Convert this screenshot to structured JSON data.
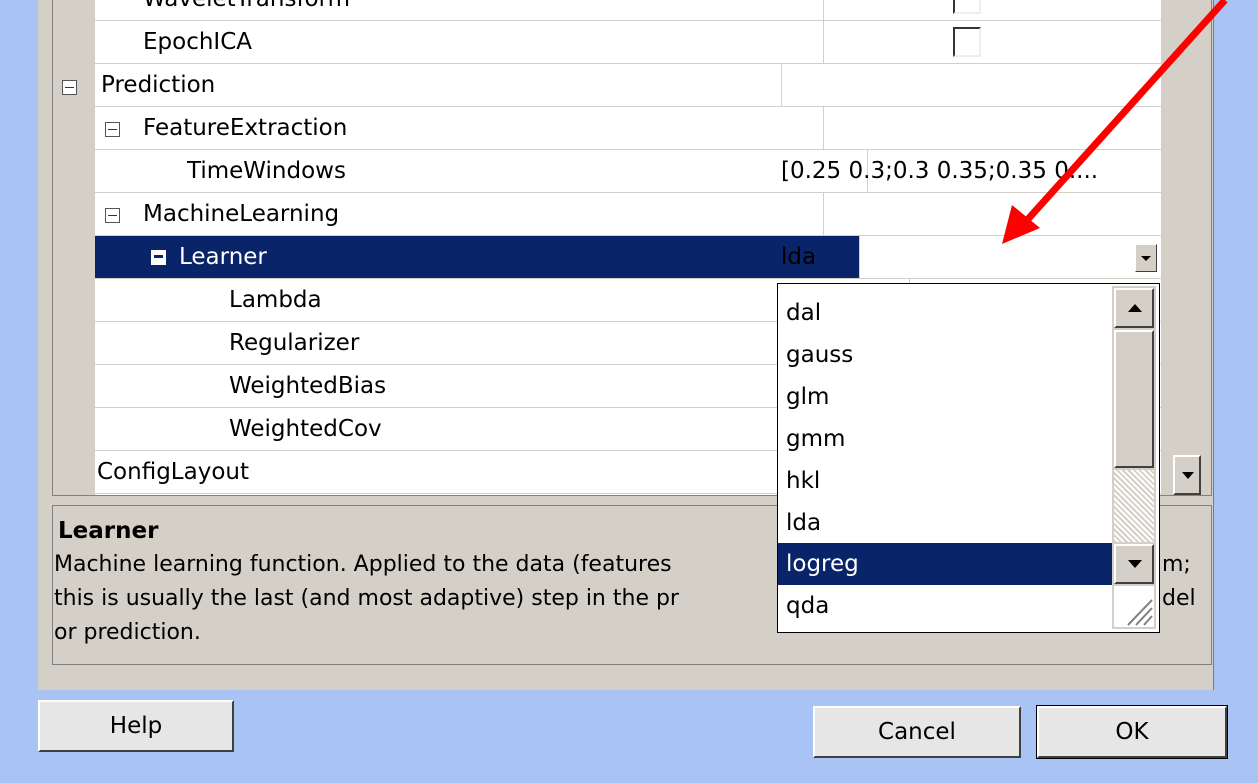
{
  "property_grid": {
    "rows": [
      {
        "label": "WaveletTransform",
        "value": "",
        "indent": 1
      },
      {
        "label": "EpochICA",
        "value": "",
        "indent": 1
      },
      {
        "label": "Prediction",
        "value": "",
        "indent": 0
      },
      {
        "label": "FeatureExtraction",
        "value": "",
        "indent": 1
      },
      {
        "label": "TimeWindows",
        "value": "[0.25 0.3;0.3 0.35;0.35 0....",
        "indent": 2
      },
      {
        "label": "MachineLearning",
        "value": "",
        "indent": 1
      },
      {
        "label": "Learner",
        "value": "lda",
        "indent": 2
      },
      {
        "label": "Lambda",
        "value": "",
        "indent": 3
      },
      {
        "label": "Regularizer",
        "value": "",
        "indent": 3
      },
      {
        "label": "WeightedBias",
        "value": "",
        "indent": 3
      },
      {
        "label": "WeightedCov",
        "value": "",
        "indent": 3
      },
      {
        "label": "ConfigLayout",
        "value": "",
        "indent": 0
      }
    ]
  },
  "dropdown": {
    "options": [
      "dal",
      "gauss",
      "glm",
      "gmm",
      "hkl",
      "lda",
      "logreg",
      "qda"
    ],
    "highlighted": "logreg"
  },
  "description": {
    "title": "Learner",
    "line1": "Machine learning function.  Applied to the data (features",
    "line1_end": "m;",
    "line2": "this is usually the last (and most adaptive) step in the pr",
    "line2_end": "del",
    "line3": "or prediction."
  },
  "buttons": {
    "help": "Help",
    "cancel": "Cancel",
    "ok": "OK"
  },
  "colors": {
    "annotation_arrow": "#ff0000",
    "selection": "#0a246a",
    "dialog_background": "#a9c3f5"
  }
}
